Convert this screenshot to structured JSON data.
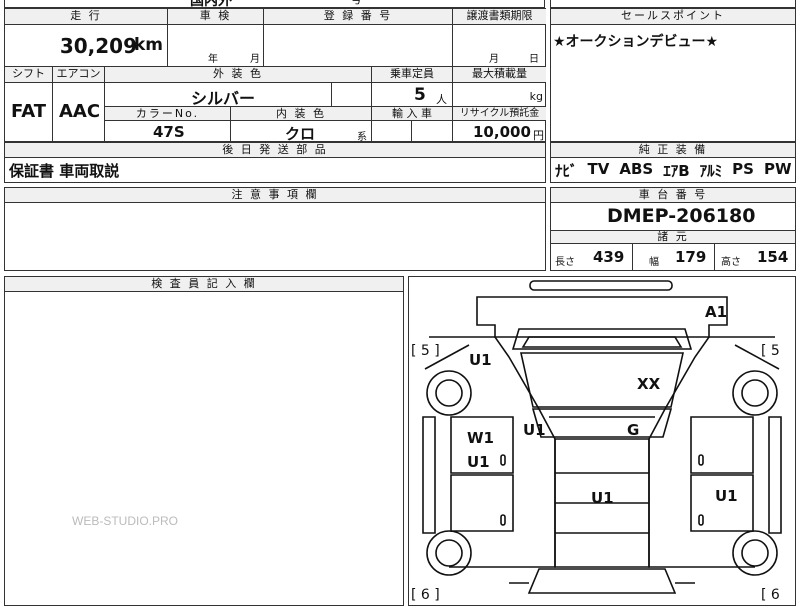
{
  "sheet": {
    "top_cutoff_text": "国内外",
    "top_cutoff_text2": "号"
  },
  "mileage": {
    "header": "走 行",
    "value": "30,209",
    "unit": "km"
  },
  "inspection": {
    "header": "車 検",
    "year_label": "年",
    "month_label": "月"
  },
  "registration": {
    "header": "登 録 番 号",
    "value": ""
  },
  "transfer": {
    "header": "譲渡書類期限",
    "month_label": "月",
    "day_label": "日"
  },
  "sales_point": {
    "header": "セールスポイント",
    "text": "★オークションデビュー★"
  },
  "shift": {
    "header": "シフト",
    "value": "FAT"
  },
  "aircon": {
    "header": "エアコン",
    "value": "AAC"
  },
  "exterior_color": {
    "header": "外 装 色",
    "value": "シルバー"
  },
  "capacity": {
    "header": "乗車定員",
    "value": "5",
    "unit": "人"
  },
  "max_load": {
    "header": "最大積載量",
    "value": "",
    "unit": "kg"
  },
  "color_no": {
    "header": "カラーNo.",
    "value": "47S"
  },
  "interior_color": {
    "header": "内 装 色",
    "value": "クロ",
    "suffix": "系"
  },
  "import": {
    "header": "輸 入 車",
    "value": ""
  },
  "recycle": {
    "header": "リサイクル預託金",
    "value": "10,000",
    "unit": "円"
  },
  "later_parts": {
    "header": "後 日 発 送 部 品",
    "value": "保証書 車両取説"
  },
  "equipment": {
    "header": "純 正 装 備",
    "items": [
      "ﾅﾋﾞ",
      "TV",
      "ABS",
      "ｴｱB",
      "ｱﾙﾐ",
      "PS",
      "PW"
    ]
  },
  "notes": {
    "header": "注 意 事 項 欄",
    "value": ""
  },
  "chassis": {
    "header": "車 台 番 号",
    "value": "DMEP-206180"
  },
  "specs": {
    "header": "諸 元",
    "length_label": "長さ",
    "length": "439",
    "width_label": "幅",
    "width": "179",
    "height_label": "高さ",
    "height": "154"
  },
  "inspector": {
    "header": "検 査 員 記 入 欄",
    "value": ""
  },
  "diagram": {
    "marks": {
      "a1": "A1",
      "u1_left_top": "U1",
      "xx": "XX",
      "u1_center": "U1",
      "g": "G",
      "w1": "W1",
      "u1_left_mid": "U1",
      "u1_lower_center": "U1",
      "u1_right": "U1"
    },
    "bracket_tl": "[ 5 ]",
    "bracket_tr": "[ 5",
    "bracket_bl": "[ 6 ]",
    "bracket_br": "[ 6"
  },
  "watermark": "WEB-STUDIO.PRO"
}
